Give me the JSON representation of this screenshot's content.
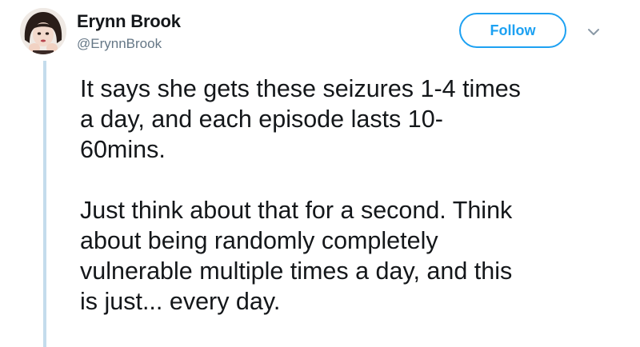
{
  "tweet": {
    "author": {
      "name": "Erynn Brook",
      "handle": "@ErynnBrook",
      "avatar_icon": "profile-photo"
    },
    "follow_button": {
      "label": "Follow",
      "color": "#1da1f2"
    },
    "more_menu_icon": "chevron-down-icon",
    "paragraphs": [
      {
        "lines": [
          "It says she gets these seizures 1-4 times",
          "a day, and each episode lasts 10-",
          "60mins."
        ]
      },
      {
        "lines": [
          "Just think about that for a second. Think",
          "about being randomly completely",
          "vulnerable multiple times a day, and this",
          "is just... every day."
        ]
      }
    ],
    "thread_line_color": "#c4dcec"
  }
}
